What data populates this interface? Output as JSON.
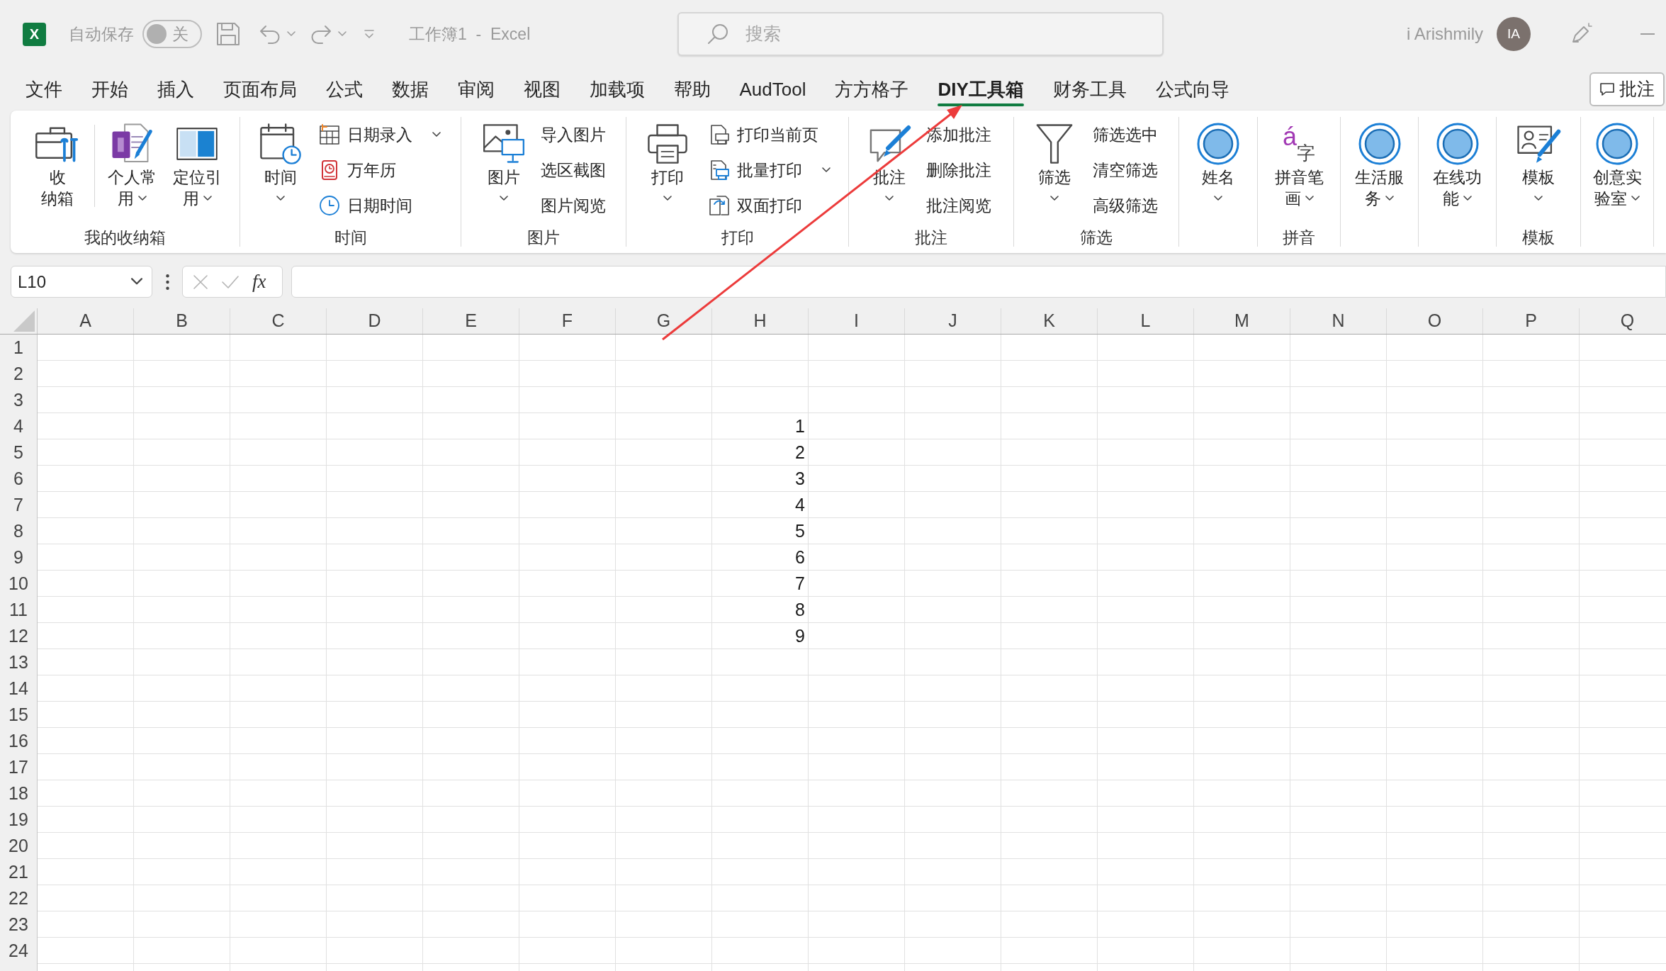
{
  "title_bar": {
    "app_logo_letter": "X",
    "autosave_label": "自动保存",
    "autosave": {
      "on": false,
      "label": "关"
    },
    "document_title": "工作簿1  -  Excel",
    "search": {
      "placeholder": "搜索"
    },
    "user_name": "i Arishmily",
    "avatar_initials": "IA"
  },
  "ribbon_tabs": [
    {
      "label": "文件",
      "selected": false
    },
    {
      "label": "开始",
      "selected": false
    },
    {
      "label": "插入",
      "selected": false
    },
    {
      "label": "页面布局",
      "selected": false
    },
    {
      "label": "公式",
      "selected": false
    },
    {
      "label": "数据",
      "selected": false
    },
    {
      "label": "审阅",
      "selected": false
    },
    {
      "label": "视图",
      "selected": false
    },
    {
      "label": "加载项",
      "selected": false
    },
    {
      "label": "帮助",
      "selected": false
    },
    {
      "label": "AudTool",
      "selected": false
    },
    {
      "label": "方方格子",
      "selected": false
    },
    {
      "label": "DIY工具箱",
      "selected": true
    },
    {
      "label": "财务工具",
      "selected": false
    },
    {
      "label": "公式向导",
      "selected": false
    }
  ],
  "comments_button": {
    "label": "批注"
  },
  "ribbon_groups": [
    {
      "label": "我的收纳箱",
      "items": [
        {
          "kind": "large",
          "label_lines": [
            "收",
            "纳箱"
          ],
          "dropdown": false
        },
        {
          "kind": "separator"
        },
        {
          "kind": "large",
          "label_lines": [
            "个人常",
            "用"
          ],
          "dropdown": true
        },
        {
          "kind": "large",
          "label_lines": [
            "定位引",
            "用"
          ],
          "dropdown": true
        }
      ]
    },
    {
      "label": "时间",
      "items": [
        {
          "kind": "large",
          "label_lines": [
            "时间"
          ],
          "dropdown": true
        },
        {
          "kind": "column",
          "buttons": [
            {
              "label": "日期录入",
              "dropdown": true
            },
            {
              "label": "万年历",
              "dropdown": false
            },
            {
              "label": "日期时间",
              "dropdown": false
            }
          ]
        }
      ]
    },
    {
      "label": "图片",
      "items": [
        {
          "kind": "large",
          "label_lines": [
            "图片"
          ],
          "dropdown": true
        },
        {
          "kind": "column",
          "buttons": [
            {
              "label": "导入图片",
              "dropdown": false
            },
            {
              "label": "选区截图",
              "dropdown": false
            },
            {
              "label": "图片阅览",
              "dropdown": false
            }
          ]
        }
      ]
    },
    {
      "label": "打印",
      "items": [
        {
          "kind": "large",
          "label_lines": [
            "打印"
          ],
          "dropdown": true
        },
        {
          "kind": "column",
          "buttons": [
            {
              "label": "打印当前页",
              "dropdown": false
            },
            {
              "label": "批量打印",
              "dropdown": true
            },
            {
              "label": "双面打印",
              "dropdown": false
            }
          ]
        }
      ]
    },
    {
      "label": "批注",
      "items": [
        {
          "kind": "large",
          "label_lines": [
            "批注"
          ],
          "dropdown": true
        },
        {
          "kind": "column",
          "buttons": [
            {
              "label": "添加批注",
              "dropdown": false
            },
            {
              "label": "删除批注",
              "dropdown": false
            },
            {
              "label": "批注阅览",
              "dropdown": false
            }
          ]
        }
      ]
    },
    {
      "label": "筛选",
      "items": [
        {
          "kind": "large",
          "label_lines": [
            "筛选"
          ],
          "dropdown": true
        },
        {
          "kind": "column",
          "buttons": [
            {
              "label": "筛选选中",
              "dropdown": false
            },
            {
              "label": "清空筛选",
              "dropdown": false
            },
            {
              "label": "高级筛选",
              "dropdown": false
            }
          ]
        }
      ]
    },
    {
      "items": [
        {
          "kind": "large",
          "label_lines": [
            "姓名"
          ],
          "dropdown": true
        }
      ]
    },
    {
      "label": "拼音",
      "items": [
        {
          "kind": "large",
          "icon_text": [
            "á",
            "字"
          ],
          "label_lines": [
            "拼音笔",
            "画"
          ],
          "dropdown": true
        }
      ]
    },
    {
      "items": [
        {
          "kind": "large",
          "label_lines": [
            "生活服",
            "务"
          ],
          "dropdown": true
        }
      ]
    },
    {
      "items": [
        {
          "kind": "large",
          "label_lines": [
            "在线功",
            "能"
          ],
          "dropdown": true
        }
      ]
    },
    {
      "label": "模板",
      "items": [
        {
          "kind": "large",
          "label_lines": [
            "模板"
          ],
          "dropdown": true
        }
      ]
    },
    {
      "items": [
        {
          "kind": "large",
          "label_lines": [
            "创意实",
            "验室"
          ],
          "dropdown": true
        }
      ]
    }
  ],
  "formula_bar": {
    "name_box": "L10",
    "function_label": "fx"
  },
  "sheet": {
    "columns": [
      "A",
      "B",
      "C",
      "D",
      "E",
      "F",
      "G",
      "H",
      "I",
      "J",
      "K",
      "L",
      "M",
      "N",
      "O",
      "P",
      "Q"
    ],
    "rows": [
      {
        "header": "1"
      },
      {
        "header": "2"
      },
      {
        "header": "3"
      },
      {
        "header": "4",
        "cells": [
          null,
          null,
          null,
          null,
          null,
          null,
          null,
          "1"
        ]
      },
      {
        "header": "5",
        "cells": [
          null,
          null,
          null,
          null,
          null,
          null,
          null,
          "2"
        ]
      },
      {
        "header": "6",
        "cells": [
          null,
          null,
          null,
          null,
          null,
          null,
          null,
          "3"
        ]
      },
      {
        "header": "7",
        "cells": [
          null,
          null,
          null,
          null,
          null,
          null,
          null,
          "4"
        ]
      },
      {
        "header": "8",
        "cells": [
          null,
          null,
          null,
          null,
          null,
          null,
          null,
          "5"
        ]
      },
      {
        "header": "9",
        "cells": [
          null,
          null,
          null,
          null,
          null,
          null,
          null,
          "6"
        ]
      },
      {
        "header": "10",
        "cells": [
          null,
          null,
          null,
          null,
          null,
          null,
          null,
          "7"
        ]
      },
      {
        "header": "11",
        "cells": [
          null,
          null,
          null,
          null,
          null,
          null,
          null,
          "8"
        ]
      },
      {
        "header": "12",
        "cells": [
          null,
          null,
          null,
          null,
          null,
          null,
          null,
          "9"
        ]
      },
      {
        "header": "13"
      },
      {
        "header": "14"
      },
      {
        "header": "15"
      },
      {
        "header": "16"
      },
      {
        "header": "17"
      },
      {
        "header": "18"
      },
      {
        "header": "19"
      },
      {
        "header": "20"
      },
      {
        "header": "21"
      },
      {
        "header": "22"
      },
      {
        "header": "23"
      },
      {
        "header": "24"
      }
    ]
  }
}
